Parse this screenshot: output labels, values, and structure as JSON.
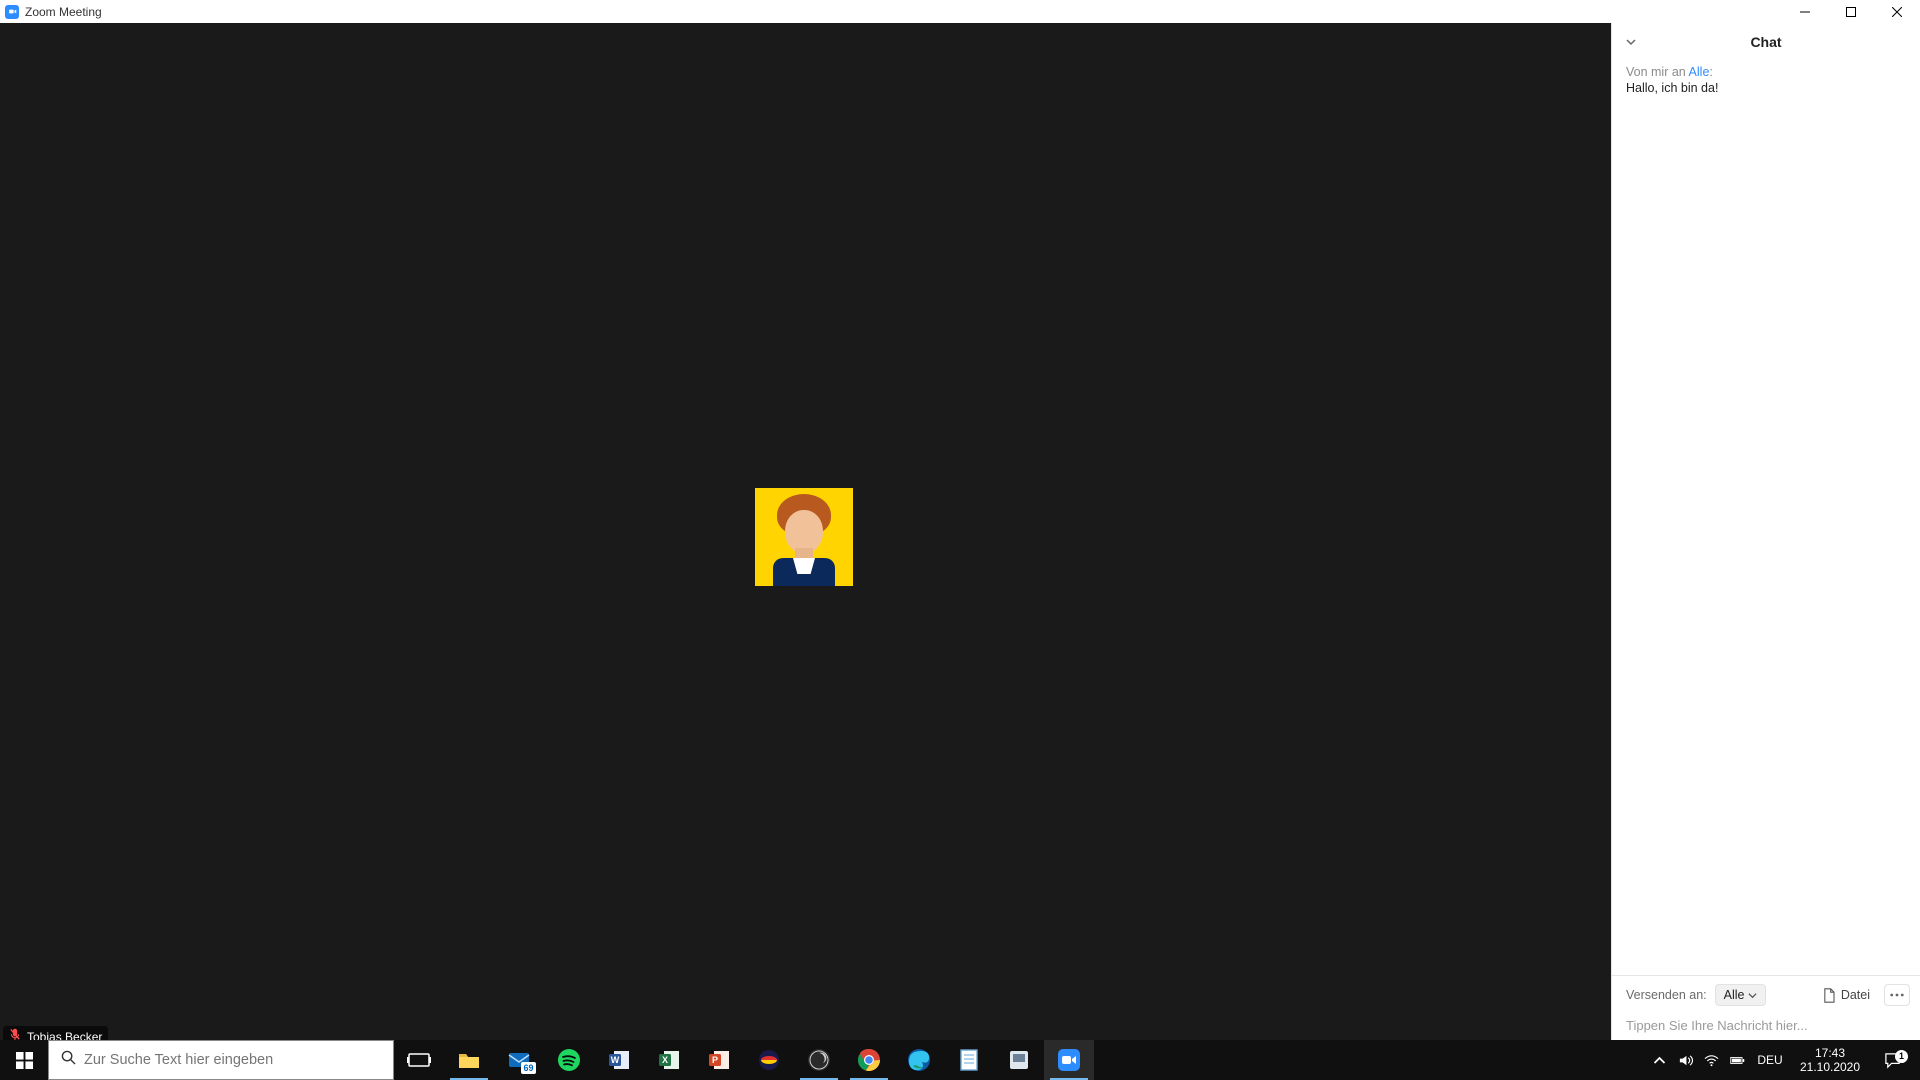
{
  "window": {
    "title": "Zoom Meeting"
  },
  "participant": {
    "name": "Tobias Becker"
  },
  "chat": {
    "title": "Chat",
    "meta_prefix": "Von mir an ",
    "meta_recipient": "Alle",
    "meta_suffix": ":",
    "message": "Hallo, ich bin da!",
    "send_to_label": "Versenden an:",
    "recipient_selected": "Alle",
    "file_label": "Datei",
    "input_placeholder": "Tippen Sie Ihre Nachricht hier..."
  },
  "taskbar": {
    "search_placeholder": "Zur Suche Text hier eingeben",
    "mail_badge": "69",
    "lang": "DEU",
    "time": "17:43",
    "date": "21.10.2020",
    "action_center_badge": "1"
  }
}
